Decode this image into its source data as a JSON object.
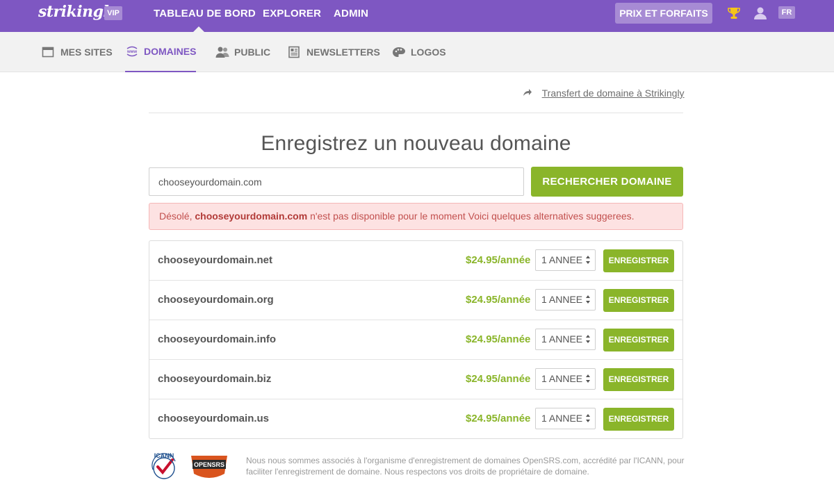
{
  "app": {
    "logo": "strikingly",
    "vip_badge": "VIP",
    "lang": "FR"
  },
  "topnav": {
    "items": [
      {
        "label": "TABLEAU DE BORD"
      },
      {
        "label": "EXPLORER"
      },
      {
        "label": "ADMIN"
      }
    ],
    "pricing": "PRIX ET FORFAITS",
    "icons": [
      "trophy-icon",
      "user-icon"
    ]
  },
  "subnav": {
    "items": [
      {
        "label": "MES SITES",
        "icon": "window-icon"
      },
      {
        "label": "DOMAINES",
        "icon": "www-icon",
        "active": true
      },
      {
        "label": "PUBLIC",
        "icon": "people-icon"
      },
      {
        "label": "NEWSLETTERS",
        "icon": "newsletter-icon"
      },
      {
        "label": "LOGOS",
        "icon": "palette-icon"
      }
    ]
  },
  "transfer_link": "Transfert de domaine à Strikingly",
  "heading": "Enregistrez un nouveau domaine",
  "search": {
    "value": "chooseyourdomain.com",
    "button": "RECHERCHER DOMAINE"
  },
  "alert": {
    "prefix": "Désolé,",
    "domain": "chooseyourdomain.com",
    "suffix": "n'est pas disponible pour le moment Voici quelques alternatives suggerees."
  },
  "results": [
    {
      "domain": "chooseyourdomain.net",
      "price": "$24.95/année",
      "period": "1 ANNEE",
      "button": "ENREGISTRER"
    },
    {
      "domain": "chooseyourdomain.org",
      "price": "$24.95/année",
      "period": "1 ANNEE",
      "button": "ENREGISTRER"
    },
    {
      "domain": "chooseyourdomain.info",
      "price": "$24.95/année",
      "period": "1 ANNEE",
      "button": "ENREGISTRER"
    },
    {
      "domain": "chooseyourdomain.biz",
      "price": "$24.95/année",
      "period": "1 ANNEE",
      "button": "ENREGISTRER"
    },
    {
      "domain": "chooseyourdomain.us",
      "price": "$24.95/année",
      "period": "1 ANNEE",
      "button": "ENREGISTRER"
    }
  ],
  "footer": {
    "icann_label": "ICANN",
    "opensrs_label": "OPENSRS",
    "text": "Nous nous sommes associés à l'organisme d'enregistrement de domaines OpenSRS.com, accrédité par l'ICANN, pour faciliter l'enregistrement de domaine. Nous respectons vos droits de propriétaire de domaine."
  },
  "colors": {
    "brand": "#7e57c2",
    "accent_green": "#8ab52a",
    "alert_bg": "#fde2e2",
    "alert_text": "#c2504e"
  }
}
